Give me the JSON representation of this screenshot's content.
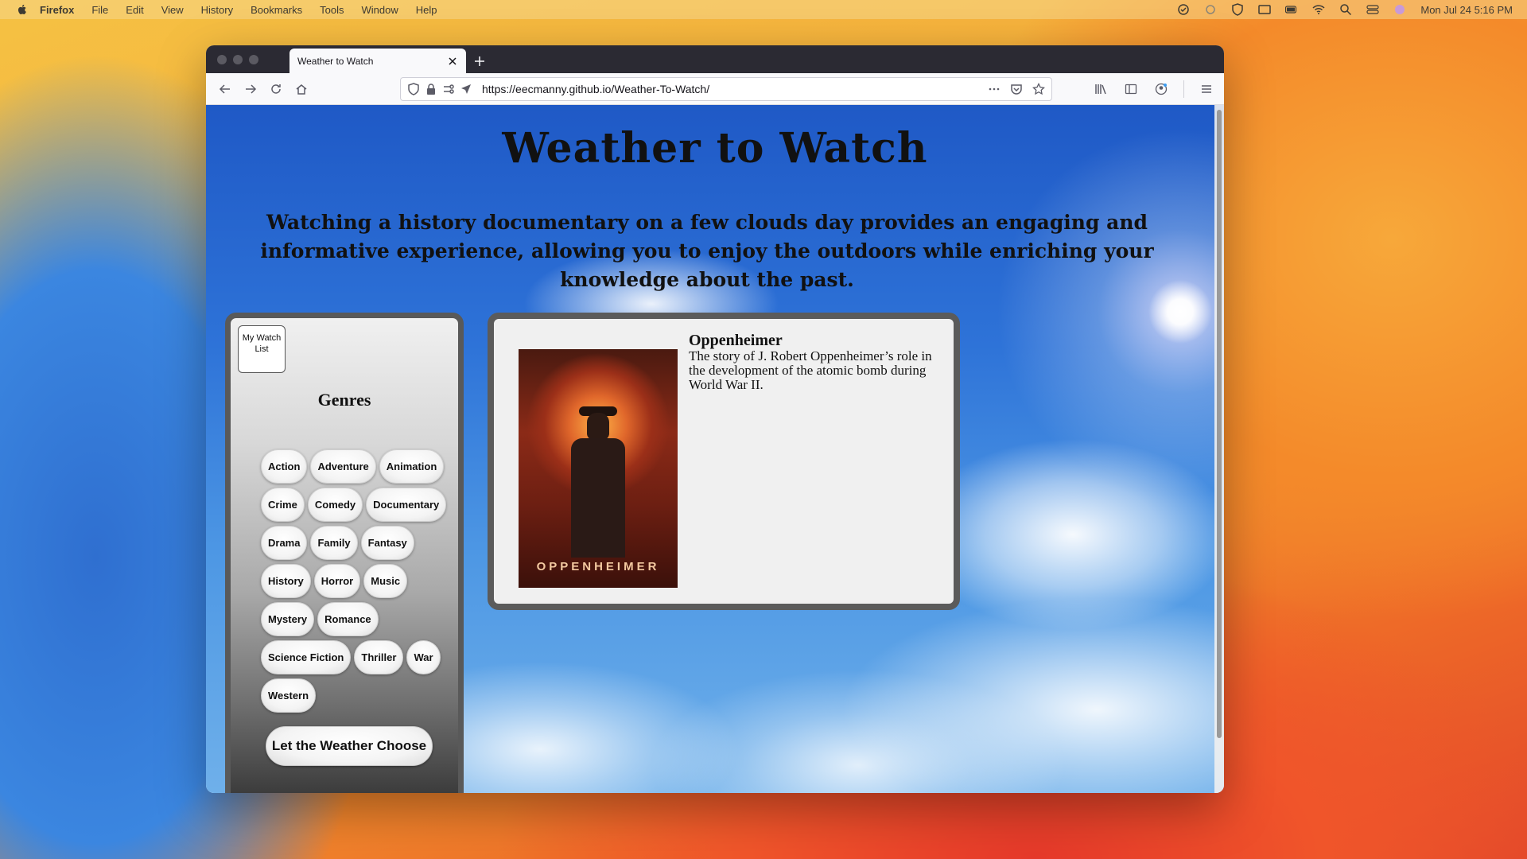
{
  "menubar": {
    "app": "Firefox",
    "items": [
      "File",
      "Edit",
      "View",
      "History",
      "Bookmarks",
      "Tools",
      "Window",
      "Help"
    ],
    "clock": "Mon Jul 24  5:16 PM"
  },
  "browser": {
    "tab_title": "Weather to Watch",
    "url_prefix": "https://",
    "url_host": "eecmanny.github.io",
    "url_path": "/Weather-To-Watch/"
  },
  "page": {
    "title": "Weather to Watch",
    "recommendation": "Watching a history documentary on a few clouds day provides an engaging and informative experience, allowing you to enjoy the outdoors while enriching your knowledge about the past.",
    "watchlist_label": "My Watch List",
    "genres_heading": "Genres",
    "genres": [
      "Action",
      "Adventure",
      "Animation",
      "Crime",
      "Comedy",
      "Documentary",
      "Drama",
      "Family",
      "Fantasy",
      "History",
      "Horror",
      "Music",
      "Mystery",
      "Romance",
      "Science Fiction",
      "Thriller",
      "War",
      "Western"
    ],
    "weather_button": "Let the Weather Choose",
    "movie": {
      "title": "Oppenheimer",
      "description": "The story of J. Robert Oppenheimer’s role in the development of the atomic bomb during World War II.",
      "poster_text": "OPPENHEIMER"
    }
  }
}
